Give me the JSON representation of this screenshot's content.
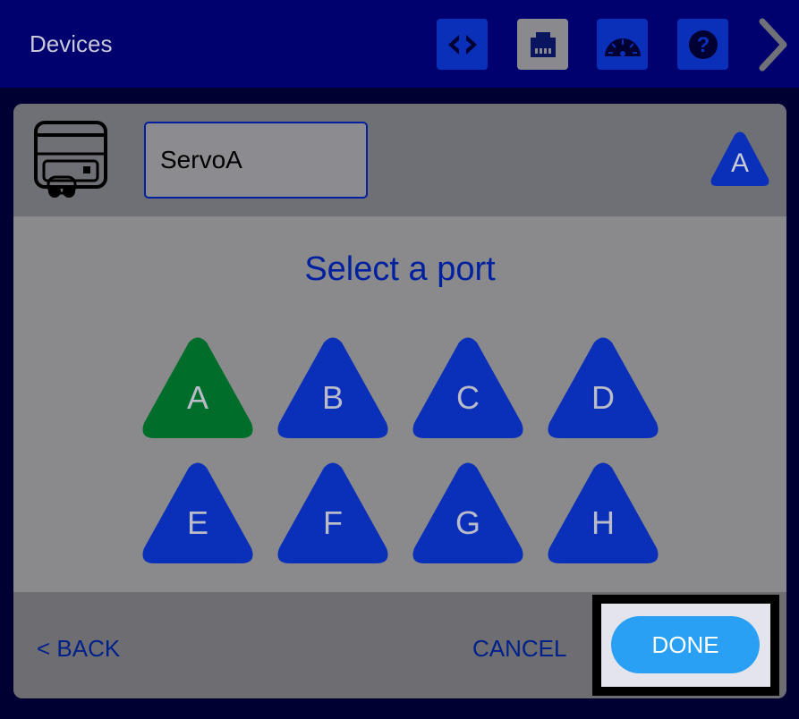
{
  "header": {
    "title": "Devices",
    "icons": [
      "code-icon",
      "ethernet-port-icon",
      "dashboard-gauge-icon",
      "help-icon",
      "chevron-right-icon"
    ]
  },
  "device": {
    "icon": "servo-motor-icon",
    "name": "ServoA",
    "port": "A"
  },
  "port_select": {
    "title": "Select a port",
    "selected": "A",
    "ports": [
      "A",
      "B",
      "C",
      "D",
      "E",
      "F",
      "G",
      "H"
    ]
  },
  "footer": {
    "back_label": "< BACK",
    "cancel_label": "CANCEL",
    "done_label": "DONE"
  },
  "colors": {
    "topbar": "#00006e",
    "port_default": "#0a2fb8",
    "port_selected": "#006e2a",
    "done": "#2aa0f5",
    "text_accent": "#0020a0"
  }
}
